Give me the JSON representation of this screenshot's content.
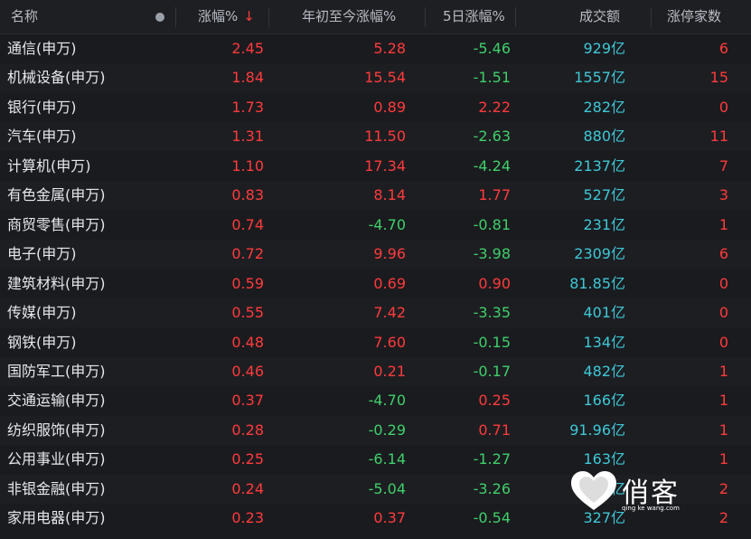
{
  "header": {
    "name": "名称",
    "change": "涨幅%",
    "sort_indicator": "↓",
    "ytd": "年初至今涨幅%",
    "five_day": "5日涨幅%",
    "turnover": "成交额",
    "limit_up": "涨停家数"
  },
  "colors": {
    "up": "#ff3b3b",
    "down": "#3fd06a",
    "turnover": "#3ec8d6",
    "background": "#1a1b1f"
  },
  "rows": [
    {
      "name": "通信(申万)",
      "change": "2.45",
      "ytd": "5.28",
      "five_day": "-5.46",
      "turnover": "929亿",
      "limit_up": "6"
    },
    {
      "name": "机械设备(申万)",
      "change": "1.84",
      "ytd": "15.54",
      "five_day": "-1.51",
      "turnover": "1557亿",
      "limit_up": "15"
    },
    {
      "name": "银行(申万)",
      "change": "1.73",
      "ytd": "0.89",
      "five_day": "2.22",
      "turnover": "282亿",
      "limit_up": "0"
    },
    {
      "name": "汽车(申万)",
      "change": "1.31",
      "ytd": "11.50",
      "five_day": "-2.63",
      "turnover": "880亿",
      "limit_up": "11"
    },
    {
      "name": "计算机(申万)",
      "change": "1.10",
      "ytd": "17.34",
      "five_day": "-4.24",
      "turnover": "2137亿",
      "limit_up": "7"
    },
    {
      "name": "有色金属(申万)",
      "change": "0.83",
      "ytd": "8.14",
      "five_day": "1.77",
      "turnover": "527亿",
      "limit_up": "3"
    },
    {
      "name": "商贸零售(申万)",
      "change": "0.74",
      "ytd": "-4.70",
      "five_day": "-0.81",
      "turnover": "231亿",
      "limit_up": "1"
    },
    {
      "name": "电子(申万)",
      "change": "0.72",
      "ytd": "9.96",
      "five_day": "-3.98",
      "turnover": "2309亿",
      "limit_up": "6"
    },
    {
      "name": "建筑材料(申万)",
      "change": "0.59",
      "ytd": "0.69",
      "five_day": "0.90",
      "turnover": "81.85亿",
      "limit_up": "0"
    },
    {
      "name": "传媒(申万)",
      "change": "0.55",
      "ytd": "7.42",
      "five_day": "-3.35",
      "turnover": "401亿",
      "limit_up": "0"
    },
    {
      "name": "钢铁(申万)",
      "change": "0.48",
      "ytd": "7.60",
      "five_day": "-0.15",
      "turnover": "134亿",
      "limit_up": "0"
    },
    {
      "name": "国防军工(申万)",
      "change": "0.46",
      "ytd": "0.21",
      "five_day": "-0.17",
      "turnover": "482亿",
      "limit_up": "1"
    },
    {
      "name": "交通运输(申万)",
      "change": "0.37",
      "ytd": "-4.70",
      "five_day": "0.25",
      "turnover": "166亿",
      "limit_up": "1"
    },
    {
      "name": "纺织服饰(申万)",
      "change": "0.28",
      "ytd": "-0.29",
      "five_day": "0.71",
      "turnover": "91.96亿",
      "limit_up": "1"
    },
    {
      "name": "公用事业(申万)",
      "change": "0.25",
      "ytd": "-6.14",
      "five_day": "-1.27",
      "turnover": "163亿",
      "limit_up": "1"
    },
    {
      "name": "非银金融(申万)",
      "change": "0.24",
      "ytd": "-5.04",
      "five_day": "-3.26",
      "turnover": "408亿",
      "limit_up": "2"
    },
    {
      "name": "家用电器(申万)",
      "change": "0.23",
      "ytd": "0.37",
      "five_day": "-0.54",
      "turnover": "327亿",
      "limit_up": "2"
    }
  ],
  "watermark": {
    "text": "俏客",
    "sub": "qing ke wang.com"
  }
}
